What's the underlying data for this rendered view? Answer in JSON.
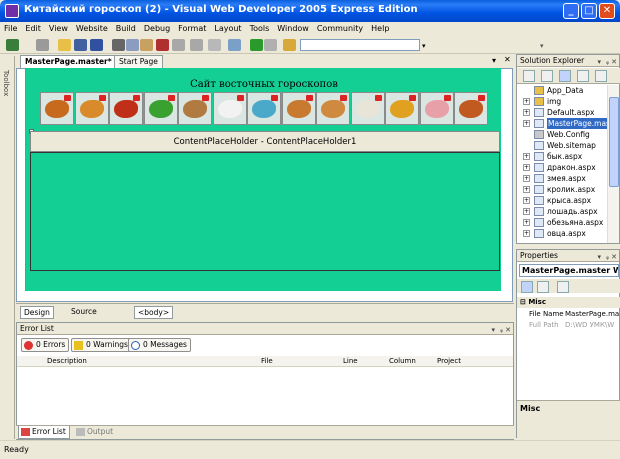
{
  "window": {
    "title": "Китайский гороскоп (2) - Visual Web Developer 2005 Express Edition",
    "controls": {
      "minimize": "_",
      "maximize": "□",
      "close": "✕"
    }
  },
  "menu": [
    "File",
    "Edit",
    "View",
    "Website",
    "Build",
    "Debug",
    "Format",
    "Layout",
    "Tools",
    "Window",
    "Community",
    "Help"
  ],
  "toolbox": {
    "label": "Toolbox"
  },
  "tabs": {
    "active": "MasterPage.master*",
    "other": "Start Page"
  },
  "page": {
    "site_title": "Сайт восточных гороскопов",
    "content_placeholder": "ContentPlaceHolder - ContentPlaceHolder1",
    "zodiac_images": [
      {
        "name": "bull-icon",
        "color": "#c86a1e"
      },
      {
        "name": "tiger-icon",
        "color": "#d98a2a"
      },
      {
        "name": "dragon-icon",
        "color": "#c03018"
      },
      {
        "name": "snake-icon",
        "color": "#3aa030"
      },
      {
        "name": "horse-icon",
        "color": "#b07a40"
      },
      {
        "name": "rabbit-icon",
        "color": "#f2f2f2"
      },
      {
        "name": "rat-icon",
        "color": "#4aa8c8"
      },
      {
        "name": "horse-icon",
        "color": "#c87a30"
      },
      {
        "name": "monkey-icon",
        "color": "#d08a40"
      },
      {
        "name": "goat-icon",
        "color": "#e8e4d8"
      },
      {
        "name": "rooster-icon",
        "color": "#e0a020"
      },
      {
        "name": "pig-icon",
        "color": "#e8a0a8"
      },
      {
        "name": "dog-icon",
        "color": "#c05a20"
      }
    ]
  },
  "designbar": {
    "design": "Design",
    "source": "Source",
    "tag": "<body>"
  },
  "errorlist": {
    "title": "Error List",
    "errors": "0 Errors",
    "warnings": "0 Warnings",
    "messages": "0 Messages",
    "columns": [
      "Description",
      "File",
      "Line",
      "Column",
      "Project"
    ]
  },
  "bottomtabs": {
    "errorlist": "Error List",
    "output": "Output"
  },
  "solution_explorer": {
    "title": "Solution Explorer",
    "items": [
      {
        "label": "App_Data",
        "expander": "",
        "icon": "folder",
        "selected": false
      },
      {
        "label": "img",
        "expander": "+",
        "icon": "folder",
        "selected": false
      },
      {
        "label": "Default.aspx",
        "expander": "+",
        "icon": "page",
        "selected": false
      },
      {
        "label": "MasterPage.mas",
        "expander": "+",
        "icon": "page",
        "selected": true
      },
      {
        "label": "Web.Config",
        "expander": "",
        "icon": "config",
        "selected": false
      },
      {
        "label": "Web.sitemap",
        "expander": "",
        "icon": "page",
        "selected": false
      },
      {
        "label": "бык.aspx",
        "expander": "+",
        "icon": "page",
        "selected": false
      },
      {
        "label": "дракон.aspx",
        "expander": "+",
        "icon": "page",
        "selected": false
      },
      {
        "label": "змея.aspx",
        "expander": "+",
        "icon": "page",
        "selected": false
      },
      {
        "label": "кролик.aspx",
        "expander": "+",
        "icon": "page",
        "selected": false
      },
      {
        "label": "крыса.aspx",
        "expander": "+",
        "icon": "page",
        "selected": false
      },
      {
        "label": "лошадь.aspx",
        "expander": "+",
        "icon": "page",
        "selected": false
      },
      {
        "label": "обезьяна.aspx",
        "expander": "+",
        "icon": "page",
        "selected": false
      },
      {
        "label": "овца.aspx",
        "expander": "+",
        "icon": "page",
        "selected": false
      }
    ]
  },
  "properties": {
    "title": "Properties",
    "selected_object": "MasterPage.master W",
    "category": "Misc",
    "rows": [
      {
        "name": "File Name",
        "value": "MasterPage.ma"
      },
      {
        "name": "Full Path",
        "value": "D:\\WD УМК\\W"
      }
    ],
    "description": "Misc"
  },
  "status": "Ready"
}
